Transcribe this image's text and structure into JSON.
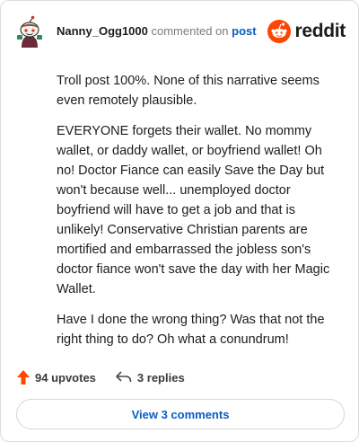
{
  "header": {
    "username": "Nanny_Ogg1000",
    "verb": "commented on",
    "target": "post",
    "brand": "reddit"
  },
  "comment": {
    "paragraphs": [
      "Troll post 100%. None of this narrative seems even remotely plausible.",
      "EVERYONE forgets their wallet. No mommy wallet, or daddy wallet, or boyfriend wallet! Oh no! Doctor Fiance can easily Save the Day but won't because well... unemployed doctor boyfriend will have to get a job and that is unlikely! Conservative Christian parents are mortified and embarrassed the jobless son's doctor fiance won't save the day with her Magic Wallet.",
      "Have I done the wrong thing? Was that not the right thing to do? Oh what a conundrum!"
    ]
  },
  "footer": {
    "upvotes_label": "94 upvotes",
    "replies_label": "3 replies",
    "view_comments_label": "View 3 comments"
  },
  "colors": {
    "accent": "#ff4500",
    "link": "#0a5dbf"
  },
  "icons": {
    "avatar": "snoo-avatar",
    "brand": "reddit-logo-icon",
    "upvote": "upvote-arrow-icon",
    "reply": "reply-arrow-icon"
  }
}
